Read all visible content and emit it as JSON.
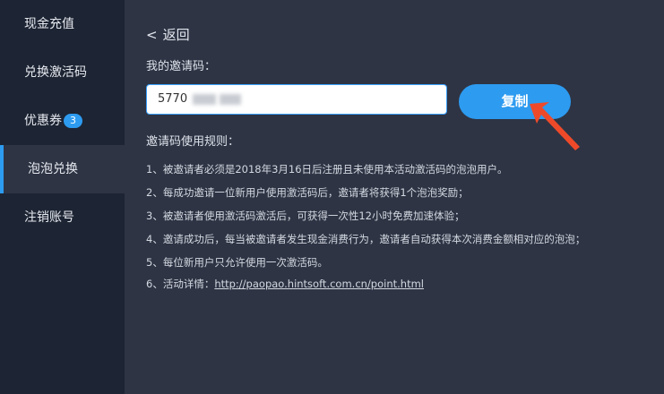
{
  "sidebar": {
    "items": [
      {
        "label": "现金充值"
      },
      {
        "label": "兑换激活码"
      },
      {
        "label": "优惠券",
        "badge": "3"
      },
      {
        "label": "泡泡兑换"
      },
      {
        "label": "注销账号"
      }
    ]
  },
  "main": {
    "back_label": "返回",
    "back_chevron": "<",
    "code_label": "我的邀请码：",
    "code_value": "5770",
    "copy_label": "复制",
    "rules_title": "邀请码使用规则：",
    "rules": [
      "1、被邀请者必须是2018年3月16日后注册且未使用本活动激活码的泡泡用户。",
      "2、每成功邀请一位新用户使用激活码后，邀请者将获得1个泡泡奖励；",
      "3、被邀请者使用激活码激活后，可获得一次性12小时免费加速体验；",
      "4、邀请成功后，每当被邀请者发生现金消费行为，邀请者自动获得本次消费金额相对应的泡泡；",
      "5、每位新用户只允许使用一次激活码。"
    ],
    "rule6_prefix": "6、活动详情：",
    "rule6_link": "http://paopao.hintsoft.com.cn/point.html"
  },
  "colors": {
    "accent": "#2d9bf0",
    "arrow": "#ee4a2a",
    "sidebar_bg": "#1d2433",
    "main_bg": "#2e3444"
  },
  "icons": {
    "back": "chevron-left-icon",
    "annotation": "red-arrow-icon"
  }
}
